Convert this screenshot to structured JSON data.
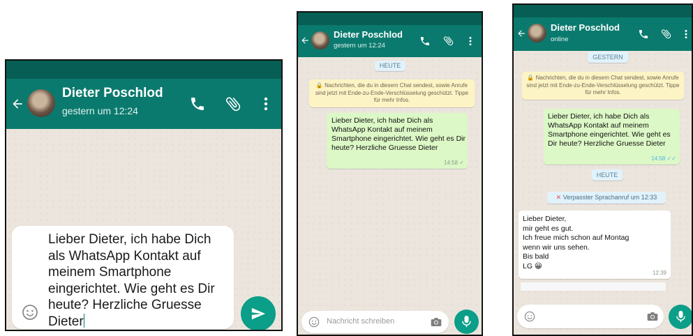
{
  "contact": {
    "name": "Dieter Poschlod",
    "last_seen": "gestern um 12:24",
    "status_online": "online"
  },
  "screen1": {
    "compose_text": "Lieber Dieter, ich habe Dich als WhatsApp Kontakt auf meinem Smartphone eingerichtet. Wie geht es Dir heute? Herzliche Gruesse Dieter"
  },
  "screen2": {
    "date_chip": "HEUTE",
    "encryption_notice": "🔒 Nachrichten, die du in diesem Chat sendest, sowie Anrufe sind jetzt mit Ende-zu-Ende-Verschlüsselung geschützt. Tippe für mehr Infos.",
    "message": "Lieber Dieter, ich habe Dich als WhatsApp Kontakt auf meinem Smartphone eingerichtet. Wie geht es Dir heute? Herzliche Gruesse Dieter",
    "message_time": "14:58 ✓",
    "input_placeholder": "Nachricht schreiben"
  },
  "screen3": {
    "date_chip_1": "GESTERN",
    "encryption_notice": "🔒 Nachrichten, die du in diesem Chat sendest, sowie Anrufe sind jetzt mit Ende-zu-Ende-Verschlüsselung geschützt. Tippe für mehr Infos.",
    "message_out": "Lieber Dieter, ich habe Dich als WhatsApp Kontakt auf meinem Smartphone eingerichtet. Wie geht es Dir heute? Herzliche Gruesse Dieter",
    "message_out_time": "14:58 ✓✓",
    "date_chip_2": "HEUTE",
    "missed_call": "Verpasster Sprachanruf um 12:33",
    "message_in_lines": [
      "Lieber Dieter,",
      "mir geht es gut.",
      "Ich freue mich schon auf Montag",
      "wenn wir uns sehen.",
      "Bis bald",
      "LG 😀"
    ],
    "message_in_time": "12:39"
  },
  "colors": {
    "header": "#0b7a6e",
    "status_bar": "#075e54",
    "outgoing_bubble": "#dcf8c6",
    "fab": "#0b9e88"
  }
}
